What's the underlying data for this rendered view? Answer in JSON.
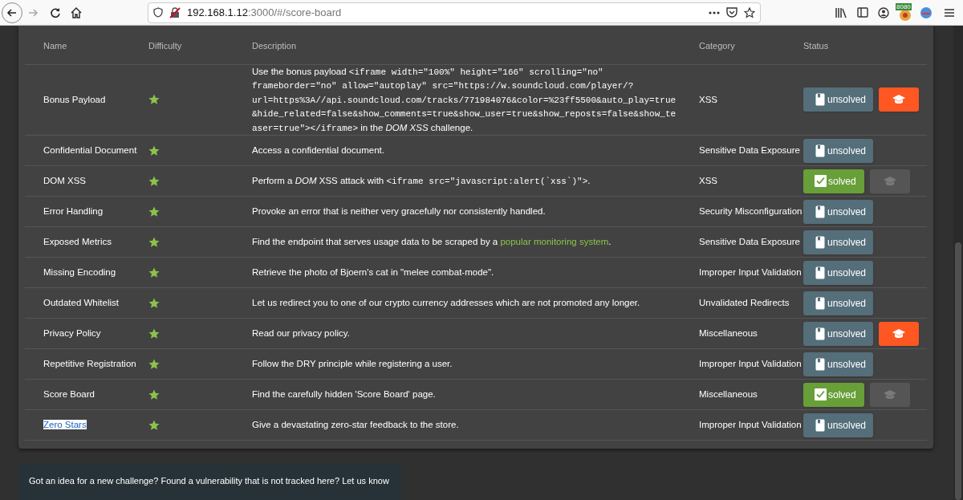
{
  "browser": {
    "url_host": "192.168.1.12",
    "url_rest": ":3000/#/score-board",
    "extension_badge": "8080"
  },
  "table": {
    "columns": [
      "Name",
      "Difficulty",
      "Description",
      "Category",
      "Status"
    ],
    "rows": [
      {
        "name": "Bonus Payload",
        "description": [
          {
            "kind": "text",
            "text": "Use the bonus payload "
          },
          {
            "kind": "code",
            "text": "<iframe width=\"100%\" height=\"166\" scrolling=\"no\" frameborder=\"no\" allow=\"autoplay\" src=\"https://w.soundcloud.com/player/?url=https%3A//api.soundcloud.com/tracks/771984076&color=%23ff5500&auto_play=true&hide_related=false&show_comments=true&show_user=true&show_reposts=false&show_teaser=true\"></iframe>"
          },
          {
            "kind": "text",
            "text": " in the *DOM XSS* challenge."
          }
        ],
        "category": "XSS",
        "status": "unsolved",
        "solved": false,
        "tutorial": {
          "disabled": false
        }
      },
      {
        "name": "Confidential Document",
        "description": [
          {
            "kind": "text",
            "text": "Access a confidential document."
          }
        ],
        "category": "Sensitive Data Exposure",
        "status": "unsolved",
        "solved": false
      },
      {
        "name": "DOM XSS",
        "description": [
          {
            "kind": "text",
            "text": "Perform a *DOM* XSS attack with "
          },
          {
            "kind": "code",
            "text": "<iframe src=\"javascript:alert(`xss`)\">"
          },
          {
            "kind": "text",
            "text": "."
          }
        ],
        "category": "XSS",
        "status": "solved",
        "solved": true,
        "tutorial": {
          "disabled": true
        }
      },
      {
        "name": "Error Handling",
        "description": [
          {
            "kind": "text",
            "text": "Provoke an error that is neither very gracefully nor consistently handled."
          }
        ],
        "category": "Security Misconfiguration",
        "status": "unsolved",
        "solved": false
      },
      {
        "name": "Exposed Metrics",
        "description": [
          {
            "kind": "text",
            "text": "Find the endpoint that serves usage data to be scraped by a "
          },
          {
            "kind": "link",
            "text": "popular monitoring system"
          },
          {
            "kind": "text",
            "text": "."
          }
        ],
        "category": "Sensitive Data Exposure",
        "status": "unsolved",
        "solved": false
      },
      {
        "name": "Missing Encoding",
        "description": [
          {
            "kind": "text",
            "text": "Retrieve the photo of Bjoern's cat in \"melee combat-mode\"."
          }
        ],
        "category": "Improper Input Validation",
        "status": "unsolved",
        "solved": false
      },
      {
        "name": "Outdated Whitelist",
        "description": [
          {
            "kind": "text",
            "text": "Let us redirect you to one of our crypto currency addresses which are not promoted any longer."
          }
        ],
        "category": "Unvalidated Redirects",
        "status": "unsolved",
        "solved": false
      },
      {
        "name": "Privacy Policy",
        "description": [
          {
            "kind": "text",
            "text": "Read our privacy policy."
          }
        ],
        "category": "Miscellaneous",
        "status": "unsolved",
        "solved": false,
        "tutorial": {
          "disabled": false
        }
      },
      {
        "name": "Repetitive Registration",
        "description": [
          {
            "kind": "text",
            "text": "Follow the DRY principle while registering a user."
          }
        ],
        "category": "Improper Input Validation",
        "status": "unsolved",
        "solved": false
      },
      {
        "name": "Score Board",
        "description": [
          {
            "kind": "text",
            "text": "Find the carefully hidden 'Score Board' page."
          }
        ],
        "category": "Miscellaneous",
        "status": "solved",
        "solved": true,
        "tutorial": {
          "disabled": true
        }
      },
      {
        "name": "Zero Stars",
        "selected": true,
        "description": [
          {
            "kind": "text",
            "text": "Give a devastating zero-star feedback to the store."
          }
        ],
        "category": "Improper Input Validation",
        "status": "unsolved",
        "solved": false
      }
    ]
  },
  "footer": {
    "text": "Got an idea for a new challenge? Found a vulnerability that is not tracked here? Let us know"
  }
}
